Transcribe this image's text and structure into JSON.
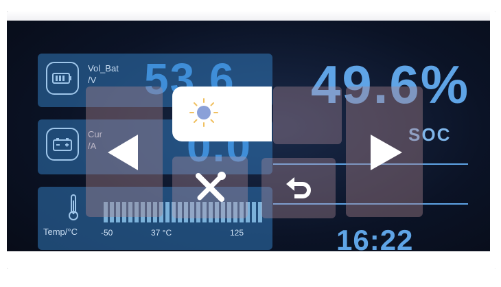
{
  "voltage_card": {
    "label": "Vol_Bat",
    "unit": "/V",
    "value": "53.6",
    "icon": "battery-icon"
  },
  "current_card": {
    "label": "Cur",
    "unit": "/A",
    "value": "0.0",
    "icon": "battery-terminals-icon"
  },
  "temp_card": {
    "label": "Temp/°C",
    "scale_min": "-50",
    "scale_mid": "37 °C",
    "scale_max": "125",
    "icon": "thermometer-icon"
  },
  "soc": {
    "value": "49.6%",
    "label": "SOC"
  },
  "clock": {
    "time": "16:22"
  },
  "overlay": {
    "prev_icon": "left-arrow-icon",
    "next_icon": "right-arrow-icon",
    "brightness_icon": "sun-icon",
    "settings_icon": "tools-icon",
    "back_icon": "back-arrow-icon"
  },
  "colors": {
    "accent": "#5fa4e6",
    "card": "#3278b9",
    "overlay": "#aa828c"
  }
}
